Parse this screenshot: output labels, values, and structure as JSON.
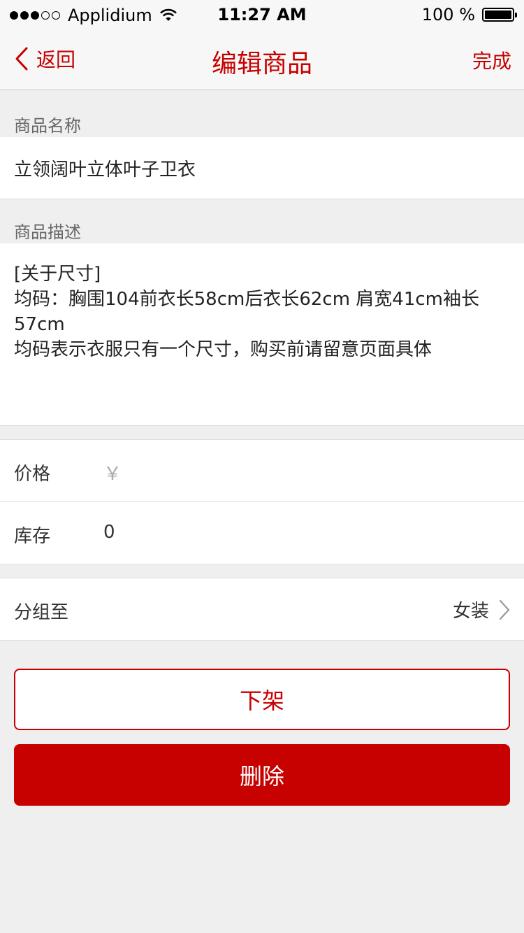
{
  "status_bar": {
    "carrier": "Applidium",
    "time": "11:27 AM",
    "battery": "100 %",
    "signal_bars_filled": 3,
    "signal_bars_total": 5
  },
  "nav": {
    "back_label": "返回",
    "title": "编辑商品",
    "done_label": "完成"
  },
  "form": {
    "name_label": "商品名称",
    "name_value": "立领阔叶立体叶子卫衣",
    "desc_label": "商品描述",
    "desc_value": "[关于尺寸]\n均码：胸围104前衣长58cm后衣长62cm 肩宽41cm袖长57cm\n均码表示衣服只有一个尺寸，购买前请留意页面具体",
    "price_label": "价格",
    "price_placeholder": "￥",
    "stock_label": "库存",
    "stock_value": "0",
    "group_label": "分组至",
    "group_value": "女装"
  },
  "actions": {
    "unlist_label": "下架",
    "delete_label": "删除"
  },
  "colors": {
    "accent": "#c70000",
    "background": "#efefef"
  }
}
